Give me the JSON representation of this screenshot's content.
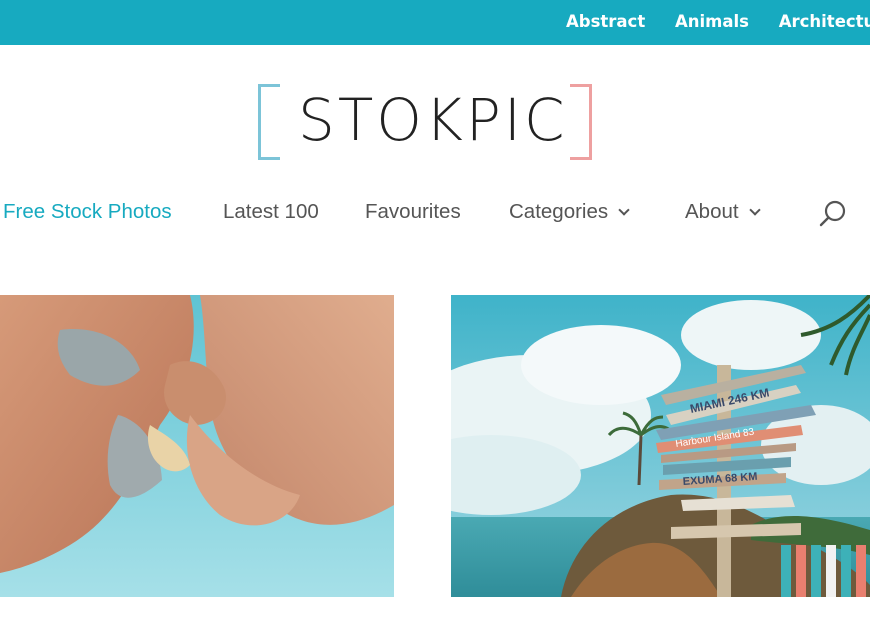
{
  "topbar": {
    "categories": [
      "Abstract",
      "Animals",
      "Architecture"
    ]
  },
  "logo": {
    "text": "STOKPIC"
  },
  "nav": {
    "items": [
      {
        "label": "Free Stock Photos",
        "active": true
      },
      {
        "label": "Latest 100",
        "active": false
      },
      {
        "label": "Favourites",
        "active": false
      },
      {
        "label": "Categories",
        "active": false,
        "dropdown": true
      },
      {
        "label": "About",
        "active": false,
        "dropdown": true
      }
    ],
    "search_icon": "search-icon"
  },
  "photos": [
    {
      "subject": "couple-from-below-sky",
      "icons": []
    },
    {
      "subject": "signpost-by-sea",
      "signs": [
        "MIAMI 246 KM",
        "Harbour Island 83",
        "EXUMA 68 KM"
      ]
    }
  ],
  "colors": {
    "accent": "#17aac0",
    "nav_text": "#555555",
    "bracket_left": "#7cc4d8",
    "bracket_right": "#eea0a0"
  }
}
